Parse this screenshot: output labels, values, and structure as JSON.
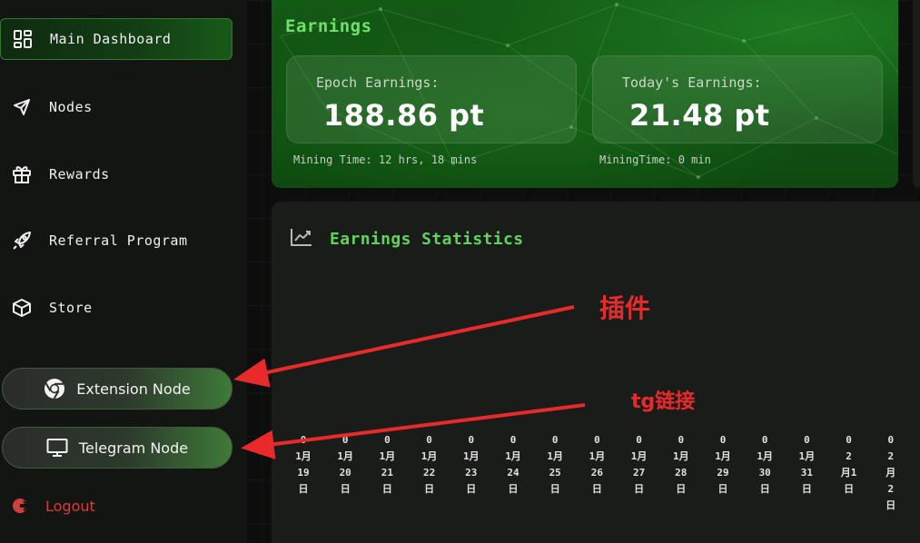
{
  "sidebar": {
    "items": [
      {
        "label": "Main Dashboard",
        "icon": "dashboard-icon"
      },
      {
        "label": "Nodes",
        "icon": "send-icon"
      },
      {
        "label": "Rewards",
        "icon": "gift-icon"
      },
      {
        "label": "Referral Program",
        "icon": "rocket-icon"
      },
      {
        "label": "Store",
        "icon": "box-icon"
      }
    ],
    "extension_node": "Extension Node",
    "telegram_node": "Telegram Node",
    "logout": "Logout"
  },
  "earnings": {
    "title": "Earnings",
    "epoch_label": "Epoch Earnings:",
    "epoch_value": "188.86 pt",
    "today_label": "Today's Earnings:",
    "today_value": "21.48 pt",
    "mining_time_epoch": "Mining Time: 12 hrs, 18 mins",
    "mining_time_today": "MiningTime: 0 min"
  },
  "stats": {
    "title": "Earnings Statistics",
    "columns": [
      {
        "value": "0",
        "date": [
          "1月",
          "19",
          "日"
        ]
      },
      {
        "value": "0",
        "date": [
          "1月",
          "20",
          "日"
        ]
      },
      {
        "value": "0",
        "date": [
          "1月",
          "21",
          "日"
        ]
      },
      {
        "value": "0",
        "date": [
          "1月",
          "22",
          "日"
        ]
      },
      {
        "value": "0",
        "date": [
          "1月",
          "23",
          "日"
        ]
      },
      {
        "value": "0",
        "date": [
          "1月",
          "24",
          "日"
        ]
      },
      {
        "value": "0",
        "date": [
          "1月",
          "25",
          "日"
        ]
      },
      {
        "value": "0",
        "date": [
          "1月",
          "26",
          "日"
        ]
      },
      {
        "value": "0",
        "date": [
          "1月",
          "27",
          "日"
        ]
      },
      {
        "value": "0",
        "date": [
          "1月",
          "28",
          "日"
        ]
      },
      {
        "value": "0",
        "date": [
          "1月",
          "29",
          "日"
        ]
      },
      {
        "value": "0",
        "date": [
          "1月",
          "30",
          "日"
        ]
      },
      {
        "value": "0",
        "date": [
          "1月",
          "31",
          "日"
        ]
      },
      {
        "value": "0",
        "date": [
          "2",
          "月1",
          "日"
        ]
      },
      {
        "value": "0",
        "date": [
          "2",
          "月",
          "2",
          "日"
        ]
      }
    ]
  },
  "annotations": {
    "plugin": "插件",
    "tg_link": "tg链接"
  },
  "colors": {
    "accent_green": "#5ed45a",
    "logout_red": "#d0403a",
    "annotation_red": "#e82a2a"
  }
}
